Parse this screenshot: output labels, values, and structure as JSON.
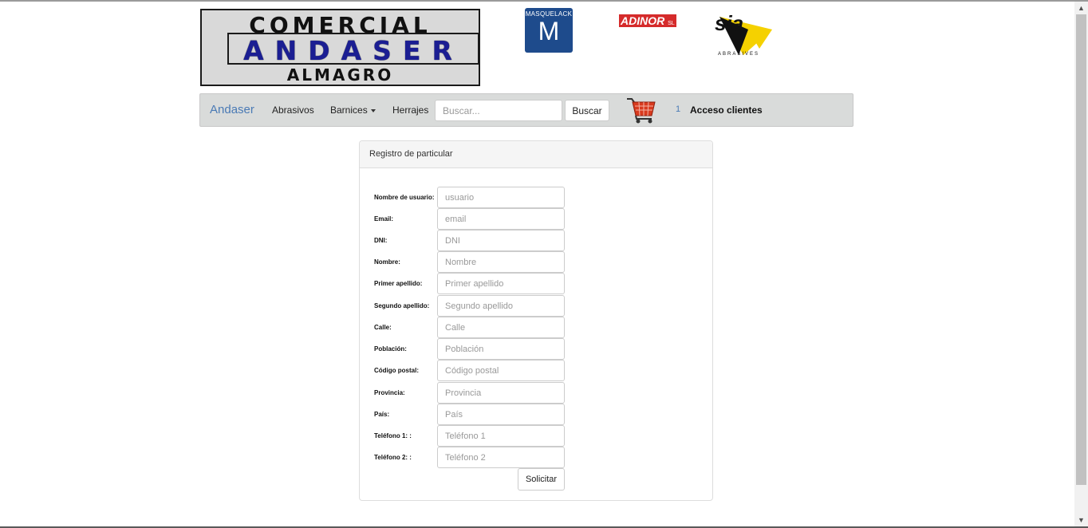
{
  "header": {
    "logo": {
      "line1": "COMERCIAL",
      "line2": "ANDASER",
      "line3": "ALMAGRO"
    },
    "brands": {
      "masquelack_name": "MASQUELACK",
      "masquelack_letter": "M",
      "adinor_name": "ADINOR",
      "adinor_suffix": "SL",
      "sia_name": "sia",
      "sia_tagline": "ABRASIVES"
    }
  },
  "navbar": {
    "brand": "Andaser",
    "items": [
      {
        "label": "Abrasivos"
      },
      {
        "label": "Barnices"
      },
      {
        "label": "Herrajes"
      }
    ],
    "search_placeholder": "Buscar...",
    "search_button": "Buscar",
    "cart_count": "1",
    "login_label": "Acceso clientes"
  },
  "panel": {
    "title": "Registro de particular",
    "fields": [
      {
        "label": "Nombre de usuario:",
        "placeholder": "usuario"
      },
      {
        "label": "Email:",
        "placeholder": "email"
      },
      {
        "label": "DNI:",
        "placeholder": "DNI"
      },
      {
        "label": "Nombre:",
        "placeholder": "Nombre"
      },
      {
        "label": "Primer apellido:",
        "placeholder": "Primer apellido"
      },
      {
        "label": "Segundo apellido:",
        "placeholder": "Segundo apellido"
      },
      {
        "label": "Calle:",
        "placeholder": "Calle"
      },
      {
        "label": "Población:",
        "placeholder": "Población"
      },
      {
        "label": "Código postal:",
        "placeholder": "Código postal"
      },
      {
        "label": "Provincia:",
        "placeholder": "Provincia"
      },
      {
        "label": "País:",
        "placeholder": "País"
      },
      {
        "label": "Teléfono 1: :",
        "placeholder": "Teléfono 1"
      },
      {
        "label": "Teléfono 2: :",
        "placeholder": "Teléfono 2"
      }
    ],
    "submit_label": "Solicitar"
  },
  "colors": {
    "accent_link": "#4a7ab5",
    "navbar_bg": "#d9dbda",
    "logo_blue": "#1b1e93",
    "masquelack_blue": "#1e4b8c",
    "adinor_red": "#d52b2b",
    "sia_yellow": "#f5d100"
  },
  "icons": {
    "cart": "shopping-cart-icon",
    "dropdown": "caret-down-icon"
  }
}
